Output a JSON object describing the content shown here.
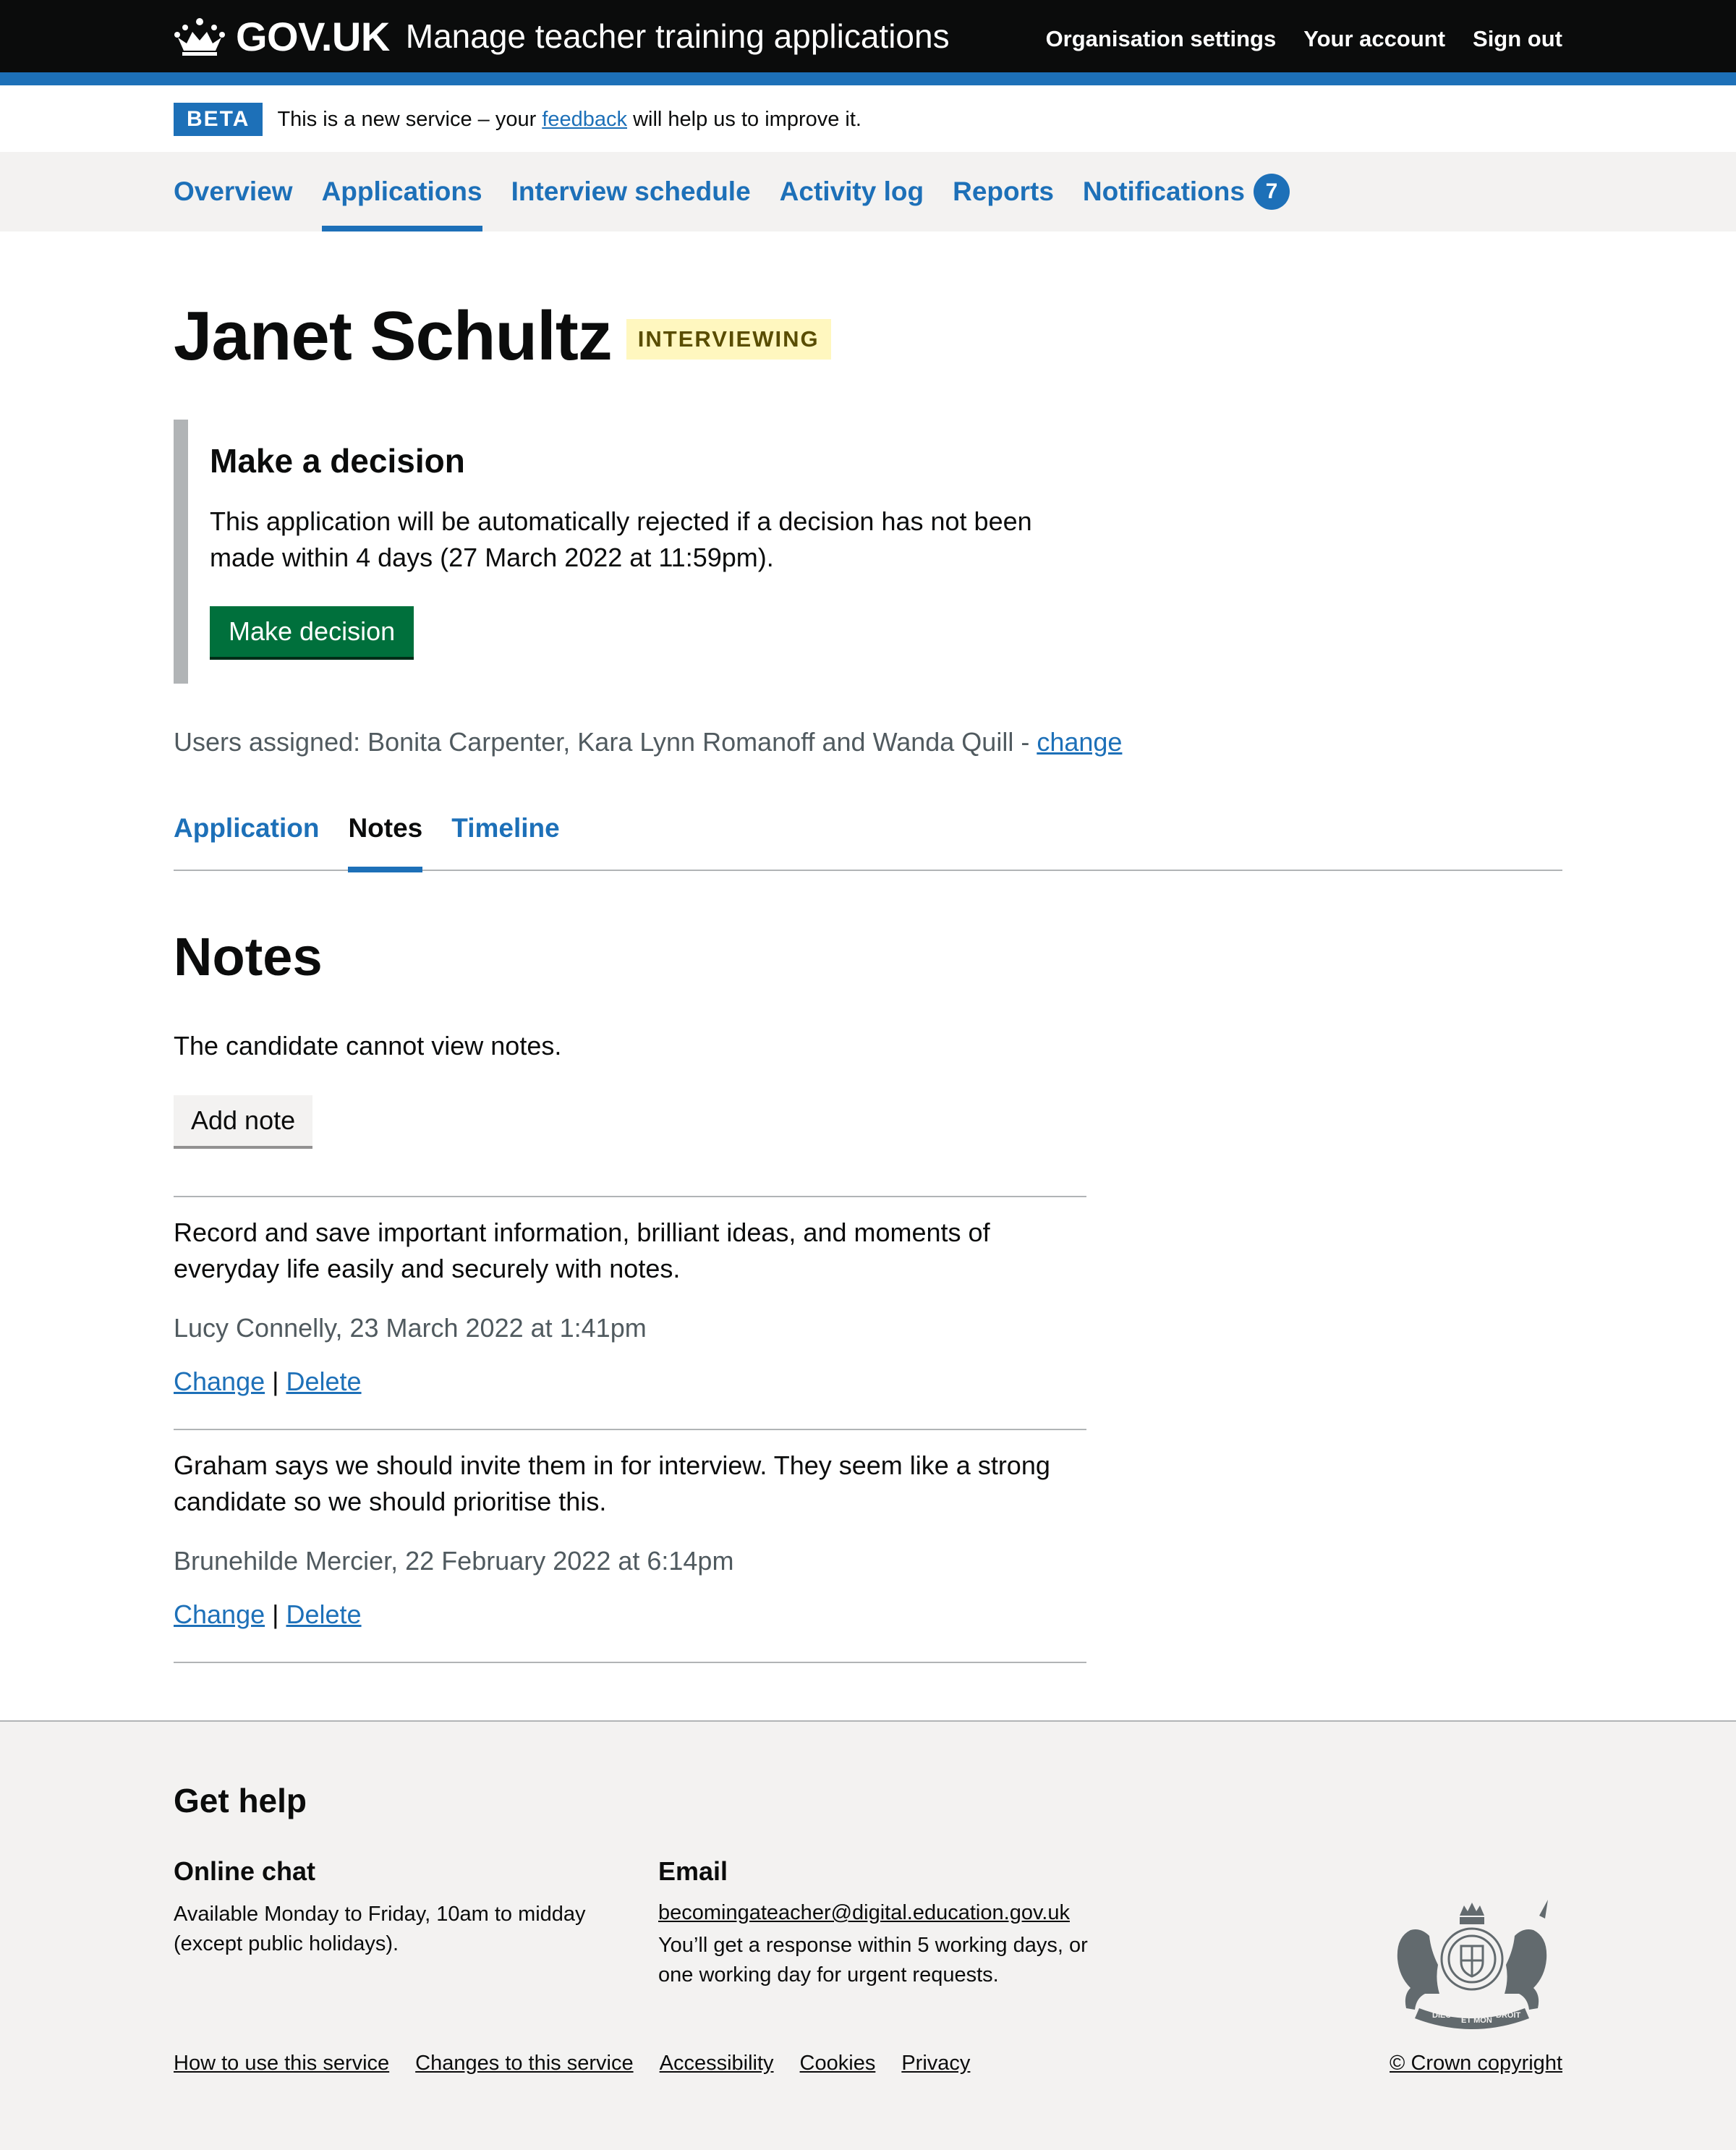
{
  "header": {
    "logo_text": "GOV.UK",
    "service_name": "Manage teacher training applications",
    "nav": [
      "Organisation settings",
      "Your account",
      "Sign out"
    ]
  },
  "beta": {
    "tag": "BETA",
    "text_before": "This is a new service – your ",
    "link": "feedback",
    "text_after": " will help us to improve it."
  },
  "primary_nav": {
    "items": [
      "Overview",
      "Applications",
      "Interview schedule",
      "Activity log",
      "Reports",
      "Notifications"
    ],
    "active": "Applications",
    "notifications_count": "7"
  },
  "candidate": {
    "name": "Janet Schultz",
    "status": "INTERVIEWING"
  },
  "decision": {
    "heading": "Make a decision",
    "text": "This application will be automatically rejected if a decision has not been made within 4 days (27 March 2022 at 11:59pm).",
    "button": "Make decision"
  },
  "assigned": {
    "text": "Users assigned: Bonita Carpenter, Kara Lynn Romanoff and Wanda Quill - ",
    "link": "change"
  },
  "tabs": {
    "items": [
      "Application",
      "Notes",
      "Timeline"
    ],
    "active": "Notes"
  },
  "notes": {
    "heading": "Notes",
    "info": "The candidate cannot view notes.",
    "add_button": "Add note",
    "change_label": "Change",
    "separator": "|",
    "delete_label": "Delete",
    "items": [
      {
        "text": "Record and save important information, brilliant ideas, and moments of everyday life easily and securely with notes.",
        "meta": "Lucy Connelly, 23 March 2022 at 1:41pm"
      },
      {
        "text": "Graham says we should invite them in for interview. They seem like a strong candidate so we should prioritise this.",
        "meta": "Brunehilde Mercier, 22 February 2022 at 6:14pm"
      }
    ]
  },
  "footer": {
    "heading": "Get help",
    "chat": {
      "heading": "Online chat",
      "text": "Available Monday to Friday, 10am to midday (except public holidays)."
    },
    "email": {
      "heading": "Email",
      "address": "becomingateacher@digital.education.gov.uk",
      "text": "You’ll get a response within 5 working days, or one working day for urgent requests."
    },
    "links": [
      "How to use this service",
      "Changes to this service",
      "Accessibility",
      "Cookies",
      "Privacy"
    ],
    "copyright": "© Crown copyright",
    "crest_motto": [
      "DIEU",
      "ET MON",
      "DROIT"
    ]
  },
  "colors": {
    "header": "#0b0c0c",
    "brand_blue": "#1d70b8",
    "button_green": "#00703c",
    "tag_yellow": "#fff7bf",
    "footer_bg": "#f3f2f1"
  }
}
